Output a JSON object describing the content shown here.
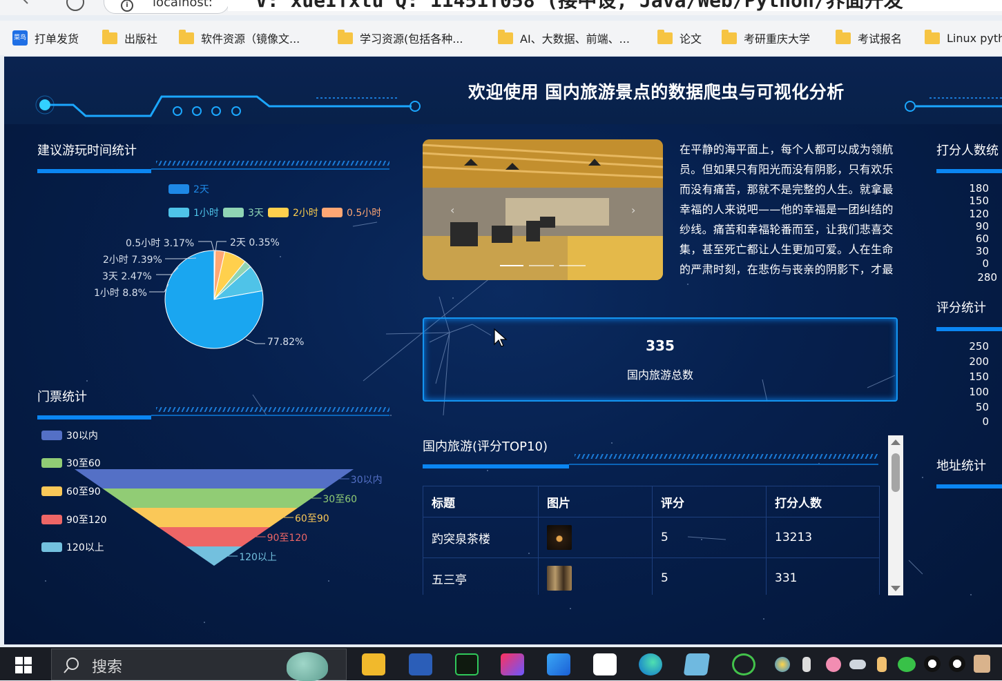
{
  "browser": {
    "url": "localhost:",
    "overlay_text": "V: xueITxtu   Q: 11451T058  (接中设, Java/Web/Python/界面开发",
    "bookmarks": [
      {
        "label": "打单发货",
        "icon": "cainiao-app-icon"
      },
      {
        "label": "出版社",
        "icon": "folder-icon"
      },
      {
        "label": "软件资源（镜像文...",
        "icon": "folder-icon"
      },
      {
        "label": "学习资源(包括各种...",
        "icon": "folder-icon"
      },
      {
        "label": "AI、大数据、前端、...",
        "icon": "folder-icon"
      },
      {
        "label": "论文",
        "icon": "folder-icon"
      },
      {
        "label": "考研重庆大学",
        "icon": "folder-icon"
      },
      {
        "label": "考试报名",
        "icon": "folder-icon"
      },
      {
        "label": "Linux pyth",
        "icon": "folder-icon"
      }
    ],
    "cainiao_icon_text": "菜鸟"
  },
  "dashboard": {
    "title": "欢迎使用 国内旅游景点的数据爬虫与可视化分析",
    "intro": "在平静的海平面上，每个人都可以成为领航员。但如果只有阳光而没有阴影，只有欢乐而没有痛苦，那就不是完整的人生。就拿最幸福的人来说吧——他的幸福是一团纠结的纱线。痛苦和幸福轮番而至，让我们悲喜交集，甚至死亡都让人生更加可爱。人在生命的严肃时刻，在悲伤与丧亲的阴影下，才最",
    "total": {
      "value": "335",
      "label": "国内旅游总数"
    },
    "right_titles": [
      "打分人数统",
      "评分统计",
      "地址统计"
    ],
    "right_axis_1": [
      "180",
      "150",
      "120",
      "90",
      "60",
      "30",
      "0",
      "280"
    ],
    "right_axis_2": [
      "250",
      "200",
      "150",
      "100",
      "50",
      "0"
    ]
  },
  "pie_panel": {
    "title": "建议游玩时间统计",
    "legend": [
      {
        "name": "2天",
        "color": "#1e88e5"
      },
      {
        "name": "1小时",
        "color": "#4fc3e8"
      },
      {
        "name": "3天",
        "color": "#8fd4b4"
      },
      {
        "name": "2小时",
        "color": "#ffd04d"
      },
      {
        "name": "0.5小时",
        "color": "#ffa774"
      }
    ],
    "labels": {
      "half_hour": "0.5小时 3.17%",
      "two_day": "2天 0.35%",
      "two_hour": "2小时 7.39%",
      "three_day": "3天 2.47%",
      "one_hour": "1小时 8.8%",
      "main": "77.82%"
    }
  },
  "funnel_panel": {
    "title": "门票统计",
    "legend": [
      {
        "name": "30以内",
        "color": "#5470c6"
      },
      {
        "name": "30至60",
        "color": "#91cc75"
      },
      {
        "name": "60至90",
        "color": "#fac858"
      },
      {
        "name": "90至120",
        "color": "#ee6666"
      },
      {
        "name": "120以上",
        "color": "#73c0de"
      }
    ]
  },
  "chart_data": [
    {
      "type": "pie",
      "title": "建议游玩时间统计",
      "legend": "top",
      "slices": [
        {
          "name": "2天",
          "value": 0.35,
          "color": "#ffa774"
        },
        {
          "name": "0.5小时",
          "value": 3.17,
          "color": "#ffa774"
        },
        {
          "name": "2小时",
          "value": 7.39,
          "color": "#ffd04d"
        },
        {
          "name": "3天",
          "value": 2.47,
          "color": "#8fd4b4"
        },
        {
          "name": "1小时",
          "value": 8.8,
          "color": "#4fc3e8"
        },
        {
          "name": "",
          "value": 77.82,
          "color": "#1aa6f0"
        }
      ]
    },
    {
      "type": "funnel",
      "title": "门票统计",
      "categories": [
        "30以内",
        "30至60",
        "60至90",
        "90至120",
        "120以上"
      ],
      "values": [
        100,
        80,
        60,
        40,
        20
      ]
    }
  ],
  "table": {
    "title": "国内旅游(评分TOP10)",
    "headers": [
      "标题",
      "图片",
      "评分",
      "打分人数"
    ],
    "rows": [
      {
        "title": "趵突泉茶楼",
        "score": "5",
        "count": "13213"
      },
      {
        "title": "五三亭",
        "score": "5",
        "count": "331"
      }
    ]
  },
  "taskbar": {
    "search_placeholder": "搜索",
    "apps": [
      "file-explorer-icon",
      "word-icon",
      "pycharm-icon",
      "intellij-icon",
      "photos-icon",
      "qq-icon",
      "edge-icon",
      "notepad-icon",
      "wechat-green-icon"
    ]
  }
}
